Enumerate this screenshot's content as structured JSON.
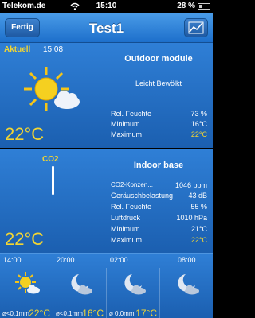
{
  "status": {
    "carrier": "Telekom.de",
    "time": "15:10",
    "battery": "28 %"
  },
  "nav": {
    "done_label": "Fertig",
    "title": "Test1"
  },
  "outdoor": {
    "current_label": "Aktuell",
    "current_time": "15:08",
    "temperature": "22°C",
    "title": "Outdoor module",
    "condition": "Leicht Bewölkt",
    "rows": [
      {
        "label": "Rel. Feuchte",
        "value": "73 %"
      },
      {
        "label": "Minimum",
        "value": "16°C"
      },
      {
        "label": "Maximum",
        "value": "22°C"
      }
    ]
  },
  "indoor": {
    "co2_label": "CO2",
    "temperature": "22°C",
    "title": "Indoor base",
    "rows": [
      {
        "label": "CO2-Konzen...",
        "value": "1046 ppm"
      },
      {
        "label": "Geräuschbelastung",
        "value": "43 dB"
      },
      {
        "label": "Rel. Feuchte",
        "value": "55 %"
      },
      {
        "label": "Luftdruck",
        "value": "1010 hPa"
      },
      {
        "label": "Minimum",
        "value": "21°C"
      },
      {
        "label": "Maximum",
        "value": "22°C"
      }
    ]
  },
  "forecast": [
    {
      "time": "14:00",
      "rain": "⌀<0.1mm",
      "temp": "22°C",
      "icon": "sun-icon"
    },
    {
      "time": "20:00",
      "rain": "⌀<0.1mm",
      "temp": "16°C",
      "icon": "moon-cloud-icon"
    },
    {
      "time": "02:00",
      "rain": "⌀ 0.0mm",
      "temp": "17°C",
      "icon": "moon-cloud-icon"
    },
    {
      "time": "08:00",
      "rain": "",
      "temp": "",
      "icon": ""
    }
  ],
  "colors": {
    "accent_yellow": "#f2d533",
    "panel_blue": "#2f7fd6",
    "nav_blue": "#1d6fcb"
  }
}
